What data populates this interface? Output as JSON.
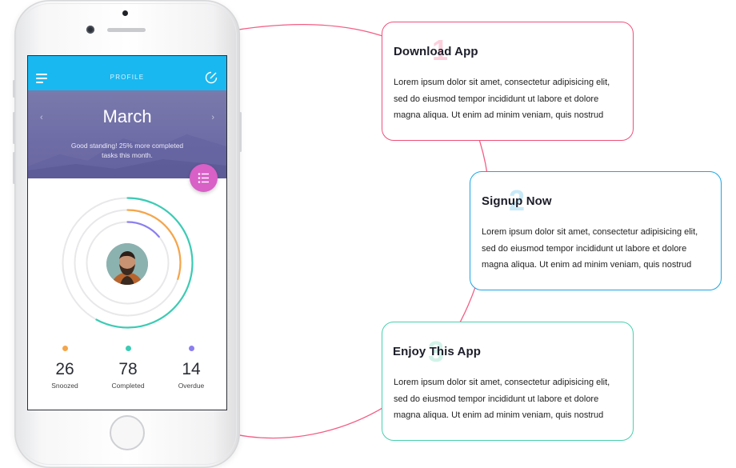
{
  "phone": {
    "topbar_title": "PROFILE",
    "month": "March",
    "standing_text": "Good standing! 25% more completed tasks this month.",
    "nav_prev": "‹",
    "nav_next": "›",
    "stats": [
      {
        "value": "26",
        "label": "Snoozed",
        "color": "#f5a54a"
      },
      {
        "value": "78",
        "label": "Completed",
        "color": "#3ccbb4"
      },
      {
        "value": "14",
        "label": "Overdue",
        "color": "#8b7ff0"
      }
    ],
    "progress": {
      "outer": 0.58,
      "middle": 0.3,
      "inner": 0.14
    }
  },
  "steps": [
    {
      "number": "1",
      "title": "Download App",
      "body": "Lorem ipsum dolor sit amet, consectetur adipisicing elit, sed do eiusmod tempor incididunt ut labore et dolore magna aliqua. Ut enim ad minim veniam, quis nostrud",
      "border": "#f0507a",
      "num_color": "#fbd0dc"
    },
    {
      "number": "2",
      "title": "Signup Now",
      "body": "Lorem ipsum dolor sit amet, consectetur adipisicing elit, sed do eiusmod tempor incididunt ut labore et dolore magna aliqua. Ut enim ad minim veniam, quis nostrud",
      "border": "#19a6e6",
      "num_color": "#c8e9f8"
    },
    {
      "number": "3",
      "title": "Enjoy This App",
      "body": "Lorem ipsum dolor sit amet, consectetur adipisicing elit, sed do eiusmod tempor incididunt ut labore et dolore magna aliqua. Ut enim ad minim veniam, quis nostrud",
      "border": "#48cfae",
      "num_color": "#d2f3e9"
    }
  ],
  "colors": {
    "arc": "#f24d78",
    "topbar": "#19b8f0",
    "fab": "#d860c6"
  }
}
